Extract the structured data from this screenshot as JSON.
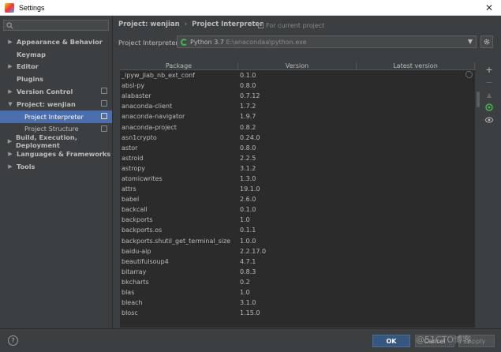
{
  "window": {
    "title": "Settings"
  },
  "sidebar": {
    "search_placeholder": "",
    "items": [
      {
        "label": "Appearance & Behavior",
        "expandable": true
      },
      {
        "label": "Keymap",
        "expandable": false
      },
      {
        "label": "Editor",
        "expandable": true
      },
      {
        "label": "Plugins",
        "expandable": false
      },
      {
        "label": "Version Control",
        "expandable": true
      },
      {
        "label": "Project: wenjian",
        "expandable": true,
        "expanded": true
      },
      {
        "label": "Project Interpreter",
        "child": true,
        "selected": true
      },
      {
        "label": "Project Structure",
        "child": true
      },
      {
        "label": "Build, Execution, Deployment",
        "expandable": true
      },
      {
        "label": "Languages & Frameworks",
        "expandable": true
      },
      {
        "label": "Tools",
        "expandable": true
      }
    ]
  },
  "breadcrumb": {
    "project": "Project: wenjian",
    "page": "Project Interpreter",
    "separator": "›"
  },
  "scope_note": "For current project",
  "interpreter": {
    "label": "Project Interpreter:",
    "name": "Python 3.7",
    "path": "E:\\anacondaa\\python.exe"
  },
  "table": {
    "headers": [
      "Package",
      "Version",
      "Latest version"
    ],
    "rows": [
      [
        "_ipyw_jlab_nb_ext_conf",
        "0.1.0"
      ],
      [
        "absl-py",
        "0.8.0"
      ],
      [
        "alabaster",
        "0.7.12"
      ],
      [
        "anaconda-client",
        "1.7.2"
      ],
      [
        "anaconda-navigator",
        "1.9.7"
      ],
      [
        "anaconda-project",
        "0.8.2"
      ],
      [
        "asn1crypto",
        "0.24.0"
      ],
      [
        "astor",
        "0.8.0"
      ],
      [
        "astroid",
        "2.2.5"
      ],
      [
        "astropy",
        "3.1.2"
      ],
      [
        "atomicwrites",
        "1.3.0"
      ],
      [
        "attrs",
        "19.1.0"
      ],
      [
        "babel",
        "2.6.0"
      ],
      [
        "backcall",
        "0.1.0"
      ],
      [
        "backports",
        "1.0"
      ],
      [
        "backports.os",
        "0.1.1"
      ],
      [
        "backports.shutil_get_terminal_size",
        "1.0.0"
      ],
      [
        "baidu-aip",
        "2.2.17.0"
      ],
      [
        "beautifulsoup4",
        "4.7.1"
      ],
      [
        "bitarray",
        "0.8.3"
      ],
      [
        "bkcharts",
        "0.2"
      ],
      [
        "blas",
        "1.0"
      ],
      [
        "bleach",
        "3.1.0"
      ],
      [
        "blosc",
        "1.15.0"
      ]
    ]
  },
  "toolbar": {
    "add": "+",
    "remove": "−",
    "upgrade": "▲"
  },
  "buttons": {
    "ok": "OK",
    "cancel": "Cancel",
    "apply": "Apply",
    "help": "?"
  },
  "watermark": "@51CTO博客",
  "colors": {
    "selection": "#4b6eaf",
    "ok_button": "#365880",
    "interpreter_icon": "#4caf50"
  }
}
